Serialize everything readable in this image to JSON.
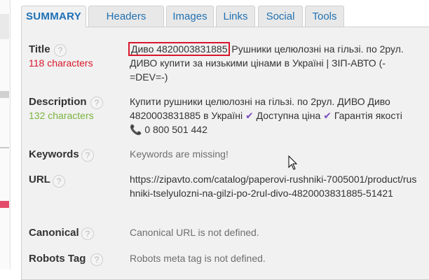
{
  "tabs": [
    {
      "label": "SUMMARY",
      "active": true
    },
    {
      "label": "Headers"
    },
    {
      "label": "Images"
    },
    {
      "label": "Links"
    },
    {
      "label": "Social"
    },
    {
      "label": "Tools"
    }
  ],
  "title": {
    "label": "Title",
    "count": "118 characters",
    "count_color": "#d8182b",
    "highlight": "Диво 4820003831885",
    "text": "Рушники целюлозні на гільзі. по 2рул. ДИВО купити за низькими цінами в Україні | ЗІП-АВТО (-=DEV=-)"
  },
  "description": {
    "label": "Description",
    "count": "132 characters",
    "count_color": "#7ab43e",
    "part1": "Купити рушники целюлозні на гільзі. по 2рул. ДИВО Диво 4820003831885 в Україні",
    "part2": "Доступна ціна",
    "part3": "Гарантія якості",
    "part4": "0 800 501 442"
  },
  "keywords": {
    "label": "Keywords",
    "value": "Keywords are missing!"
  },
  "url": {
    "label": "URL",
    "value": "https://zipavto.com/catalog/paperovi-rushniki-7005001/product/rushniki-tselyulozni-na-gilzi-po-2rul-divo-4820003831885-51421"
  },
  "canonical": {
    "label": "Canonical",
    "value": "Canonical URL is not defined."
  },
  "robots": {
    "label": "Robots Tag",
    "value": "Robots meta tag is not defined."
  },
  "icons": {
    "help": "?",
    "check": "✔",
    "phone": "📞"
  }
}
